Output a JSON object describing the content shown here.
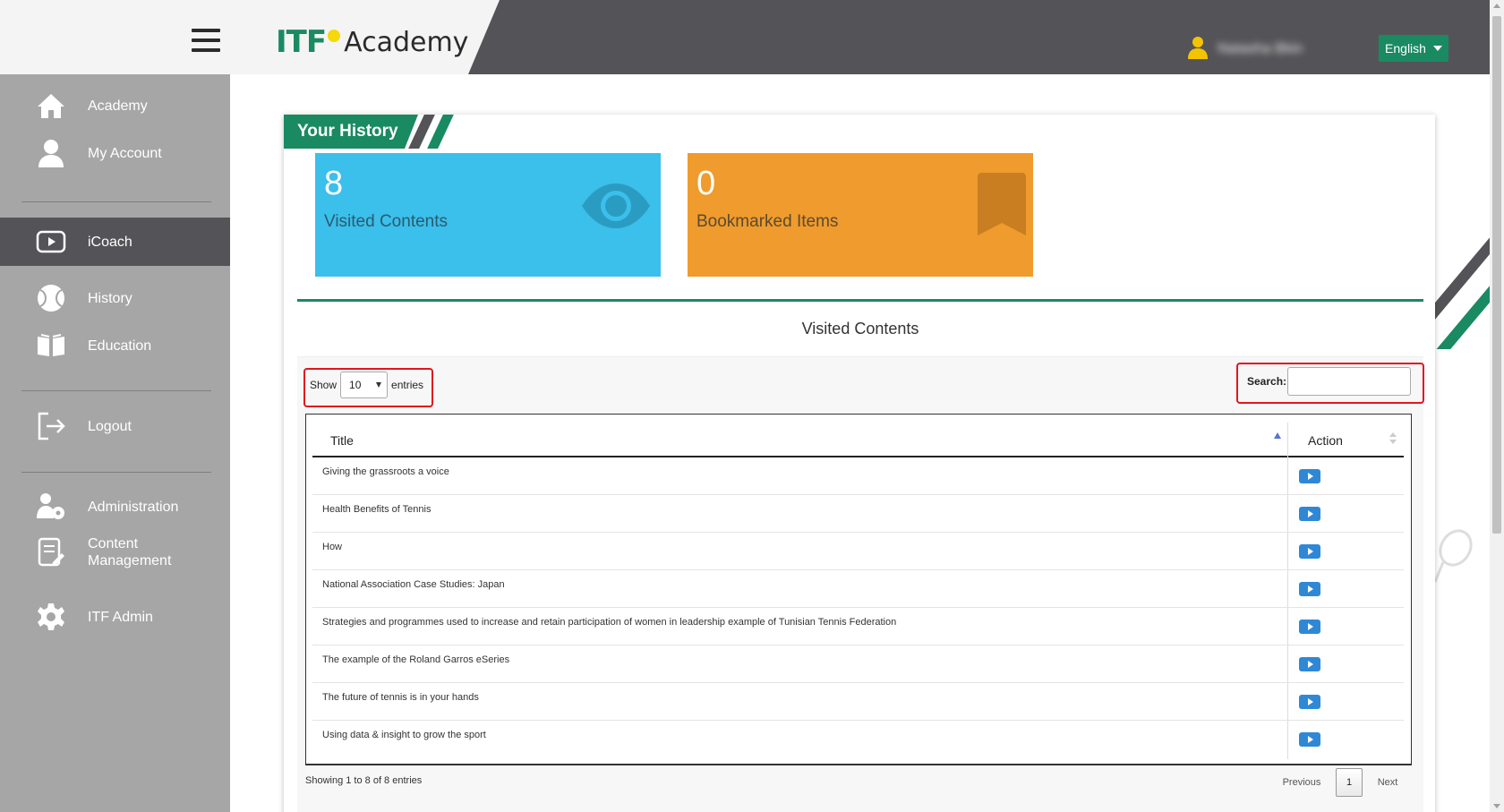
{
  "header": {
    "logo_itf": "ITF",
    "logo_academy": "Academy",
    "user_name": "Natasha Bkin",
    "language": "English"
  },
  "sidebar": {
    "items": [
      {
        "label": "Academy",
        "icon": "home-icon"
      },
      {
        "label": "My Account",
        "icon": "user-icon"
      },
      {
        "label": "iCoach",
        "icon": "play-icon",
        "active": true
      },
      {
        "label": "History",
        "icon": "tennis-ball-icon"
      },
      {
        "label": "Education",
        "icon": "book-icon"
      },
      {
        "label": "Logout",
        "icon": "logout-icon"
      },
      {
        "label": "Administration",
        "icon": "users-gear-icon"
      },
      {
        "label": "Content Management",
        "icon": "document-edit-icon"
      },
      {
        "label": "ITF Admin",
        "icon": "gear-icon"
      }
    ]
  },
  "page": {
    "title": "Your History"
  },
  "stats": [
    {
      "value": "8",
      "label": "Visited Contents",
      "color": "#3bbfeb",
      "icon": "eye-icon"
    },
    {
      "value": "0",
      "label": "Bookmarked Items",
      "color": "#ef9b2d",
      "icon": "bookmark-icon"
    }
  ],
  "panel": {
    "title": "Visited Contents",
    "show_label": "Show",
    "entries_label": "entries",
    "page_size": "10",
    "search_label": "Search:",
    "search_value": ""
  },
  "table": {
    "columns": [
      "Title",
      "Action"
    ],
    "rows": [
      "Giving the grassroots a voice",
      "Health Benefits of Tennis",
      "How",
      "National Association Case Studies: Japan",
      "Strategies and programmes used to increase and retain participation of women in leadership example of Tunisian Tennis Federation",
      "The example of the Roland Garros eSeries",
      "The future of tennis is in your hands",
      "Using data & insight to grow the sport"
    ]
  },
  "footer": {
    "info": "Showing 1 to 8 of 8 entries",
    "previous": "Previous",
    "current_page": "1",
    "next": "Next"
  },
  "colors": {
    "brand_green": "#1a8a63",
    "header_dark": "#545458",
    "sidebar_bg": "#a6a6a6",
    "highlight_red": "#e0161f",
    "play_blue": "#2f88d6"
  }
}
